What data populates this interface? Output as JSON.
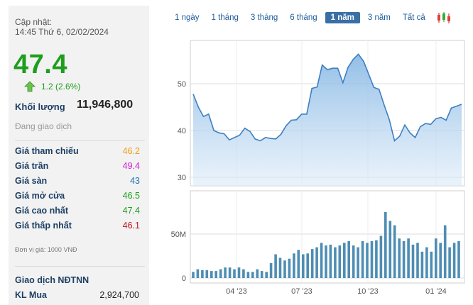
{
  "quote": {
    "updated_label": "Cập nhật:",
    "updated_time": "14:45 Thứ 6, 02/02/2024",
    "price": "47.4",
    "change": "1.2 (2.6%)",
    "volume_label": "Khối lượng",
    "volume_value": "11,946,800",
    "status": "Đang giao dịch",
    "unit_note": "Đơn vị giá: 1000 VNĐ",
    "foreign_title": "Giao dịch NĐTNN",
    "buy_label": "KL Mua",
    "buy_value": "2,924,700",
    "rows": [
      {
        "label": "Giá tham chiếu",
        "value": "46.2",
        "color": "#f39c12"
      },
      {
        "label": "Giá trần",
        "value": "49.4",
        "color": "#d21ad2"
      },
      {
        "label": "Giá sàn",
        "value": "43",
        "color": "#1e6fb5"
      },
      {
        "label": "Giá mở cửa",
        "value": "46.5",
        "color": "#1e9e1e"
      },
      {
        "label": "Giá cao nhất",
        "value": "47.4",
        "color": "#1e9e1e"
      },
      {
        "label": "Giá thấp nhất",
        "value": "46.1",
        "color": "#c0151a"
      }
    ],
    "colors": {
      "up": "#1e9e1e",
      "label": "#1d3f63"
    }
  },
  "tabs": [
    "1 ngày",
    "1 tháng",
    "3 tháng",
    "6 tháng",
    "1 năm",
    "3 năm",
    "Tất cả"
  ],
  "active_tab": "1 năm",
  "chart_data": [
    {
      "type": "area",
      "y_ticks": [
        "30",
        "40",
        "50"
      ],
      "ylim": [
        30,
        57
      ],
      "x_ticks": [
        "04 '23",
        "07 '23",
        "10 '23",
        "01 '24"
      ],
      "grid": true,
      "color": "#4a8bc9",
      "values": [
        47.8,
        45,
        43,
        43.5,
        40,
        39.5,
        39.3,
        38,
        38.5,
        39,
        40.5,
        39.8,
        38.2,
        37.8,
        38.5,
        38.3,
        38.2,
        39.2,
        41,
        42.2,
        42.3,
        43.5,
        43.5,
        49,
        49.3,
        54,
        53,
        53.3,
        53.3,
        50.2,
        53.5,
        55.2,
        56.3,
        54.8,
        52,
        49.2,
        48.8,
        45.4,
        42.3,
        37.8,
        38.8,
        41.2,
        39.5,
        38.5,
        40.8,
        41.5,
        41.3,
        42.5,
        42.8,
        42.2,
        44.8,
        45.2,
        45.6
      ]
    },
    {
      "type": "bar",
      "y_ticks": [
        "0",
        "50M"
      ],
      "ylim": [
        0,
        82
      ],
      "x_ticks": [
        "04 '23",
        "07 '23",
        "10 '23",
        "01 '24"
      ],
      "grid": true,
      "color": "#4e8db3",
      "values": [
        7,
        10,
        9,
        9,
        8,
        8,
        10,
        12,
        12,
        10,
        12,
        10,
        7,
        7,
        10,
        8,
        7,
        17,
        27,
        23,
        20,
        22,
        28,
        32,
        27,
        28,
        33,
        35,
        40,
        37,
        38,
        35,
        37,
        40,
        42,
        37,
        35,
        42,
        40,
        42,
        43,
        48,
        75,
        65,
        60,
        45,
        42,
        45,
        38,
        40,
        30,
        35,
        30,
        45,
        40,
        60,
        35,
        40,
        42
      ]
    }
  ]
}
